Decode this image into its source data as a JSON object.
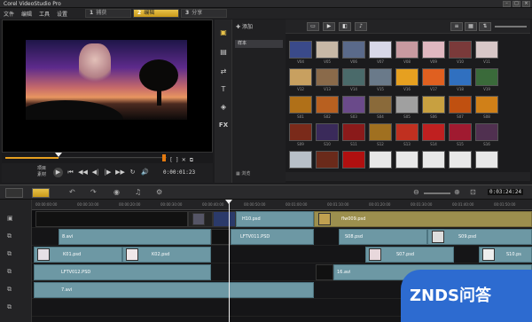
{
  "window": {
    "title": "Corel VideoStudio Pro",
    "controls": [
      "–",
      "□",
      "×"
    ]
  },
  "menu": [
    "文件",
    "编辑",
    "工具",
    "设置"
  ],
  "steps": [
    {
      "num": "1",
      "label": "捕获"
    },
    {
      "num": "2",
      "label": "编辑"
    },
    {
      "num": "3",
      "label": "分享"
    }
  ],
  "preview": {
    "mode_project": "项目",
    "mode_clip": "素材",
    "timecode": "0:00:01:23",
    "transport": [
      "⏮",
      "◀◀",
      "◀|",
      "|▶",
      "▶▶",
      "↻",
      "🔊"
    ],
    "right_buttons": [
      "[",
      "]",
      "✕",
      "⧉"
    ]
  },
  "library": {
    "add_label": "添加",
    "selected_folder": "样本",
    "browse_label": "浏览",
    "toolbar_icons": [
      "folder-icon",
      "video-icon",
      "image-icon",
      "music-icon"
    ],
    "side_icons": [
      "media-icon",
      "film-icon",
      "transition-icon",
      "title-icon",
      "graphic-icon",
      "fx-icon"
    ],
    "thumbs": [
      {
        "label": "V04",
        "color": "#3a4a8a"
      },
      {
        "label": "V05",
        "color": "#c7b8a6"
      },
      {
        "label": "V06",
        "color": "#5a6a8a"
      },
      {
        "label": "V07",
        "color": "#d8d8e8"
      },
      {
        "label": "V08",
        "color": "#c89aa0"
      },
      {
        "label": "V09",
        "color": "#e0b8c0"
      },
      {
        "label": "V10",
        "color": "#7a3a3a"
      },
      {
        "label": "V11",
        "color": "#d8c8c8"
      },
      {
        "label": "V12",
        "color": "#c8a060"
      },
      {
        "label": "V13",
        "color": "#8a6a4a"
      },
      {
        "label": "V14",
        "color": "#4a6a6a"
      },
      {
        "label": "V15",
        "color": "#6a7a8a"
      },
      {
        "label": "V16",
        "color": "#e6a020"
      },
      {
        "label": "V17",
        "color": "#e06020"
      },
      {
        "label": "V18",
        "color": "#3070c0"
      },
      {
        "label": "V19",
        "color": "#3a6a3a"
      },
      {
        "label": "S01",
        "color": "#b07018"
      },
      {
        "label": "S02",
        "color": "#b86020"
      },
      {
        "label": "S03",
        "color": "#6a4a8a"
      },
      {
        "label": "S04",
        "color": "#8a6a3a"
      },
      {
        "label": "S05",
        "color": "#a0a0a0"
      },
      {
        "label": "S06",
        "color": "#c8a040"
      },
      {
        "label": "S07",
        "color": "#c05010"
      },
      {
        "label": "S08",
        "color": "#d08018"
      },
      {
        "label": "S09",
        "color": "#7a2a1a"
      },
      {
        "label": "S10",
        "color": "#3a2a5a"
      },
      {
        "label": "S11",
        "color": "#8a1a1a"
      },
      {
        "label": "S12",
        "color": "#a07020"
      },
      {
        "label": "S13",
        "color": "#c03020"
      },
      {
        "label": "S14",
        "color": "#c02020"
      },
      {
        "label": "S15",
        "color": "#a01a30"
      },
      {
        "label": "S16",
        "color": "#503050"
      },
      {
        "label": "",
        "color": "#b8c0c8"
      },
      {
        "label": "",
        "color": "#6a2a1a"
      },
      {
        "label": "",
        "color": "#b01010"
      },
      {
        "label": "",
        "color": "#e8e8e8"
      },
      {
        "label": "",
        "color": "#e8e8e8"
      },
      {
        "label": "",
        "color": "#e8e8e8"
      },
      {
        "label": "",
        "color": "#e8e8e8"
      },
      {
        "label": "",
        "color": "#e8e8e8"
      }
    ]
  },
  "timeline": {
    "timecode": "0:03:24:24",
    "ruler": [
      "00:00:00:00",
      "00:00:10:00",
      "00:00:20:00",
      "00:00:30:00",
      "00:00:40:00",
      "00:00:50:00",
      "00:01:00:00",
      "00:01:10:00",
      "00:01:20:00",
      "00:01:30:00",
      "00:01:40:00",
      "00:01:50:00"
    ],
    "clips": [
      {
        "track": 0,
        "label": "H10.psd",
        "kind": "blue"
      },
      {
        "track": 0,
        "label": "flw009.psd",
        "kind": "gold"
      },
      {
        "track": 1,
        "label": "8.avi",
        "kind": "blue"
      },
      {
        "track": 1,
        "label": "LFTV011.PSD",
        "kind": "blue"
      },
      {
        "track": 1,
        "label": "S08.psd",
        "kind": "blue"
      },
      {
        "track": 1,
        "label": "S09.psd",
        "kind": "blue"
      },
      {
        "track": 2,
        "label": "K01.psd",
        "kind": "blue"
      },
      {
        "track": 2,
        "label": "K02.psd",
        "kind": "blue"
      },
      {
        "track": 2,
        "label": "S07.psd",
        "kind": "blue"
      },
      {
        "track": 2,
        "label": "S10.ps",
        "kind": "blue"
      },
      {
        "track": 3,
        "label": "LFTV012.PSD",
        "kind": "blue"
      },
      {
        "track": 3,
        "label": "16.avi",
        "kind": "blue"
      },
      {
        "track": 4,
        "label": "7.avi",
        "kind": "blue"
      }
    ]
  },
  "watermark": "ZNDS问答",
  "colors": {
    "accent": "#e7c24a",
    "clip": "#6d98a4",
    "brand": "#2d6bd0"
  }
}
